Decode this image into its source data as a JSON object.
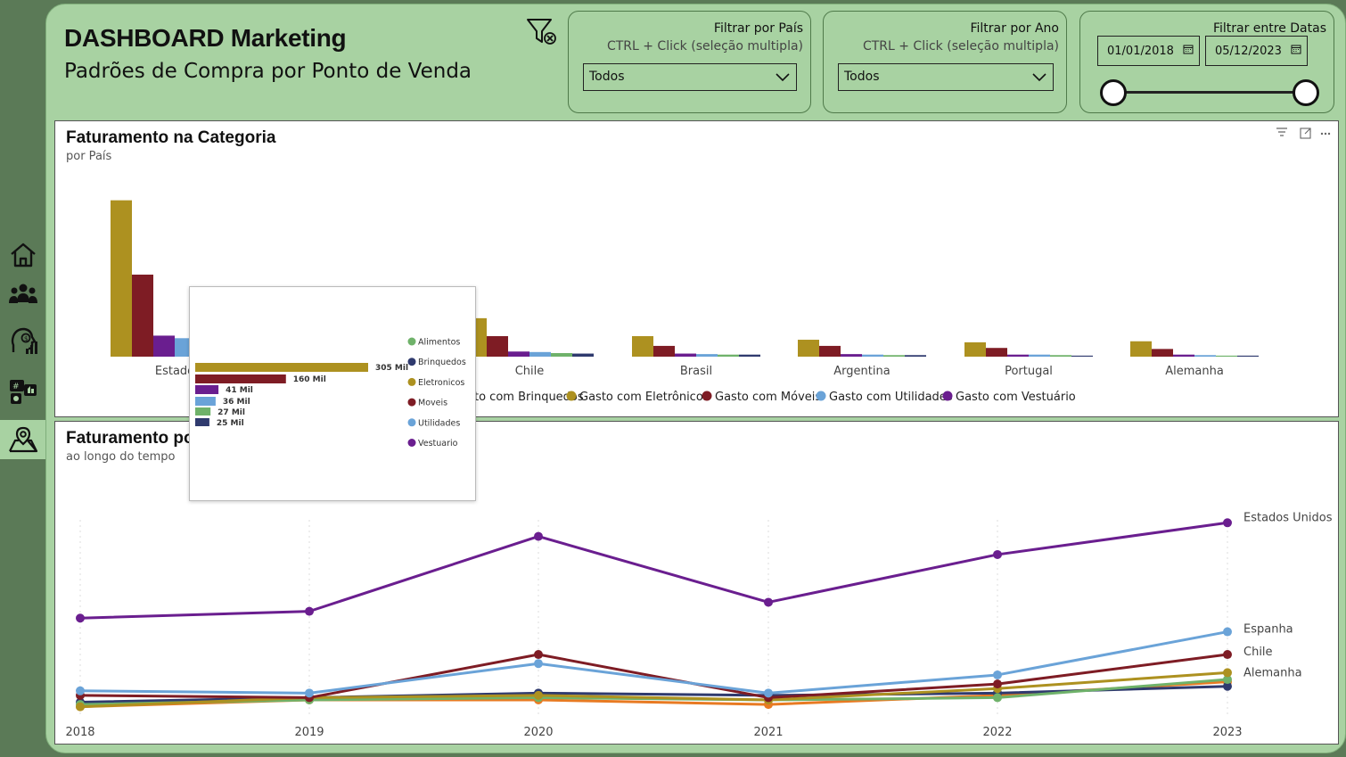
{
  "header": {
    "title": "DASHBOARD Marketing",
    "subtitle": "Padrões de Compra por Ponto de Venda"
  },
  "nav": {
    "items": [
      {
        "icon": "home-icon"
      },
      {
        "icon": "people-icon"
      },
      {
        "icon": "customer-analysis-icon"
      },
      {
        "icon": "social-media-icon"
      },
      {
        "icon": "map-location-icon",
        "active": true
      }
    ]
  },
  "filters": {
    "pais": {
      "title": "Filtrar por País",
      "hint": "CTRL + Click (seleção multipla)",
      "value": "Todos"
    },
    "ano": {
      "title": "Filtrar por Ano",
      "hint": "CTRL + Click (seleção multipla)",
      "value": "Todos"
    },
    "datas": {
      "title": "Filtrar entre Datas",
      "start": "01/01/2018",
      "end": "05/12/2023"
    }
  },
  "colors": {
    "alimentos": "#6fb26a",
    "brinquedos": "#2f3a6e",
    "eletronicos": "#ad9120",
    "moveis": "#7e1c24",
    "utilidades": "#6aa3d8",
    "vestuario": "#6a1e8f",
    "orange": "#e87a22"
  },
  "bar_chart": {
    "title": "Faturamento na Categoria",
    "subtitle": "por País",
    "legend_visible": [
      "to com Brinquedos",
      "Gasto com Eletrônicos",
      "Gasto com Móveis",
      "Gasto com Utilidades",
      "Gasto com Vestuário"
    ]
  },
  "line_chart": {
    "title": "Faturamento po",
    "subtitle": "ao longo do tempo"
  },
  "tooltip": {
    "legend": [
      "Alimentos",
      "Brinquedos",
      "Eletronicos",
      "Moveis",
      "Utilidades",
      "Vestuario"
    ],
    "bars": [
      {
        "label": "305 Mil",
        "value": 305,
        "series": "eletronicos"
      },
      {
        "label": "160 Mil",
        "value": 160,
        "series": "moveis"
      },
      {
        "label": "41 Mil",
        "value": 41,
        "series": "vestuario"
      },
      {
        "label": "36 Mil",
        "value": 36,
        "series": "utilidades"
      },
      {
        "label": "27 Mil",
        "value": 27,
        "series": "alimentos"
      },
      {
        "label": "25 Mil",
        "value": 25,
        "series": "brinquedos"
      }
    ]
  },
  "chart_data": [
    {
      "type": "bar",
      "title": "Faturamento na Categoria",
      "subtitle": "por País",
      "categories": [
        "Estado",
        "Chile",
        "Brasil",
        "Argentina",
        "Portugal",
        "Alemanha"
      ],
      "series": [
        {
          "name": "Gasto com Eletrônicos",
          "color_key": "eletronicos",
          "values": [
            305,
            75,
            40,
            33,
            28,
            30
          ]
        },
        {
          "name": "Gasto com Móveis",
          "color_key": "moveis",
          "values": [
            160,
            40,
            21,
            21,
            17,
            15
          ]
        },
        {
          "name": "Gasto com Vestuário",
          "color_key": "vestuario",
          "values": [
            41,
            10,
            6,
            5,
            4,
            4
          ]
        },
        {
          "name": "Gasto com Utilidades",
          "color_key": "utilidades",
          "values": [
            36,
            9,
            5,
            4,
            4,
            3
          ]
        },
        {
          "name": "",
          "color_key": "alimentos",
          "values": [
            27,
            7,
            4,
            3,
            3,
            2
          ]
        },
        {
          "name": "to com Brinquedos",
          "color_key": "brinquedos",
          "values": [
            25,
            6,
            4,
            3,
            2,
            2
          ]
        }
      ],
      "ylim": [
        0,
        320
      ]
    },
    {
      "type": "line",
      "title": "Faturamento po",
      "subtitle": "ao longo do tempo",
      "x": [
        "2018",
        "2019",
        "2020",
        "2021",
        "2022",
        "2023"
      ],
      "series": [
        {
          "name": "Estados Unidos",
          "color_key": "vestuario",
          "values": [
            47,
            50,
            83,
            54,
            75,
            89
          ]
        },
        {
          "name": "Espanha",
          "color_key": "utilidades",
          "values": [
            15,
            14,
            27,
            14,
            22,
            41
          ]
        },
        {
          "name": "Chile",
          "color_key": "moveis",
          "values": [
            13,
            12,
            31,
            12,
            18,
            31
          ]
        },
        {
          "name": "Alemanha",
          "color_key": "eletronicos",
          "values": [
            8,
            12,
            13,
            11,
            16,
            23
          ]
        },
        {
          "name": "",
          "color_key": "alimentos",
          "values": [
            9,
            11,
            12,
            11,
            12,
            20
          ]
        },
        {
          "name": "",
          "color_key": "brinquedos",
          "values": [
            10,
            12,
            14,
            13,
            14,
            17
          ]
        },
        {
          "name": "",
          "color_key": "orange",
          "values": [
            8,
            11,
            11,
            9,
            13,
            19
          ]
        }
      ],
      "ylim": [
        0,
        95
      ]
    }
  ]
}
